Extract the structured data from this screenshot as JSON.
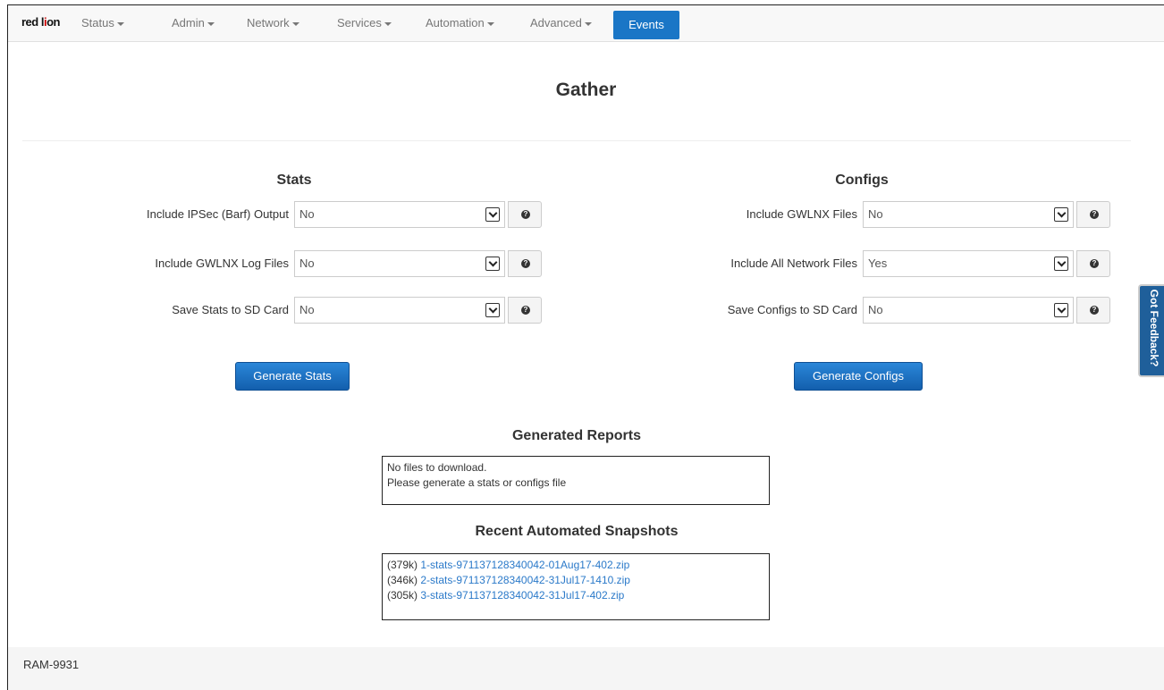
{
  "nav": {
    "logo_pre": "red l",
    "logo_o": "i",
    "logo_post": "on",
    "items": [
      {
        "label": "Status"
      },
      {
        "label": "Admin"
      },
      {
        "label": "Network"
      },
      {
        "label": "Services"
      },
      {
        "label": "Automation"
      },
      {
        "label": "Advanced"
      }
    ],
    "active": "Events"
  },
  "page": {
    "title": "Gather"
  },
  "stats": {
    "heading": "Stats",
    "rows": [
      {
        "label": "Include IPSec (Barf) Output",
        "value": "No"
      },
      {
        "label": "Include GWLNX Log Files",
        "value": "No"
      },
      {
        "label": "Save Stats to SD Card",
        "value": "No"
      }
    ],
    "button": "Generate Stats"
  },
  "configs": {
    "heading": "Configs",
    "rows": [
      {
        "label": "Include GWLNX Files",
        "value": "No"
      },
      {
        "label": "Include All Network Files",
        "value": "Yes"
      },
      {
        "label": "Save Configs to SD Card",
        "value": "No"
      }
    ],
    "button": "Generate Configs"
  },
  "reports": {
    "heading": "Generated Reports",
    "lines": [
      "No files to download.",
      "Please generate a stats or configs file"
    ]
  },
  "snapshots": {
    "heading": "Recent Automated Snapshots",
    "files": [
      {
        "size": "(379k)",
        "name": "1-stats-971137128340042-01Aug17-402.zip"
      },
      {
        "size": "(346k)",
        "name": "2-stats-971137128340042-31Jul17-1410.zip"
      },
      {
        "size": "(305k)",
        "name": "3-stats-971137128340042-31Jul17-402.zip"
      }
    ]
  },
  "feedback": "Got Feedback?",
  "footer": "RAM-9931",
  "colors": {
    "accent": "#1a76c6",
    "link": "#2a79c9",
    "feedback": "#1f5f9a"
  }
}
